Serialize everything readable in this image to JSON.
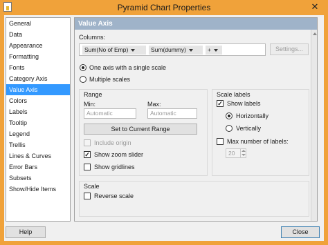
{
  "window": {
    "title": "Pyramid Chart Properties",
    "close_glyph": "✕",
    "icon": "chart-app-icon"
  },
  "nav": {
    "items": [
      {
        "label": "General"
      },
      {
        "label": "Data"
      },
      {
        "label": "Appearance"
      },
      {
        "label": "Formatting"
      },
      {
        "label": "Fonts"
      },
      {
        "label": "Category Axis"
      },
      {
        "label": "Value Axis",
        "selected": true
      },
      {
        "label": "Colors"
      },
      {
        "label": "Labels"
      },
      {
        "label": "Tooltip"
      },
      {
        "label": "Legend"
      },
      {
        "label": "Trellis"
      },
      {
        "label": "Lines & Curves"
      },
      {
        "label": "Error Bars"
      },
      {
        "label": "Subsets"
      },
      {
        "label": "Show/Hide Items"
      }
    ]
  },
  "panel": {
    "header": "Value Axis",
    "columns_label": "Columns:",
    "columns": [
      "Sum(No of Emp)",
      "Sum(dummy)",
      "+"
    ],
    "settings_button": "Settings...",
    "axis_mode": {
      "option_single": "One axis with a single scale",
      "option_multiple": "Multiple scales",
      "selected": "single"
    },
    "range": {
      "title": "Range",
      "min_label": "Min:",
      "max_label": "Max:",
      "min_value": "Automatic",
      "max_value": "Automatic",
      "set_button": "Set to Current Range",
      "include_origin": {
        "label": "Include origin",
        "checked": false,
        "disabled": true
      },
      "show_zoom_slider": {
        "label": "Show zoom slider",
        "checked": true
      },
      "show_gridlines": {
        "label": "Show gridlines",
        "checked": false
      }
    },
    "scale_labels": {
      "title": "Scale labels",
      "show_labels": {
        "label": "Show labels",
        "checked": true
      },
      "orientation_horizontal": "Horizontally",
      "orientation_vertical": "Vertically",
      "orientation_selected": "horizontal",
      "max_labels": {
        "label": "Max number of labels:",
        "checked": false,
        "value": "20"
      }
    },
    "scale": {
      "title": "Scale",
      "reverse_scale": {
        "label": "Reverse scale",
        "checked": false
      }
    }
  },
  "footer": {
    "help_button": "Help",
    "close_button": "Close"
  },
  "check_glyph": "✓"
}
